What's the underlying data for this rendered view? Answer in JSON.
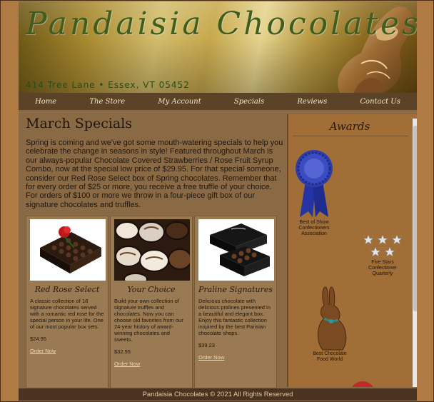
{
  "header": {
    "brand": "Pandaisia Chocolates",
    "address": "414 Tree Lane • Essex, VT 05452"
  },
  "nav": [
    "Home",
    "The Store",
    "My Account",
    "Specials",
    "Reviews",
    "Contact Us"
  ],
  "main": {
    "heading": "March Specials",
    "intro": "Spring is coming and we've got some mouth-watering specials to help you celebrate the change in seasons in style! Featured throughout March is our always-popular Chocolate Covered Strawberries / Rose Fruit Syrup Combo, now at the special low price of $29.95. For that special someone, consider our Red Rose Select box of Spring chocolates. Remember that for every order of $25 or more, you receive a free truffle of your choice. For orders of $100 or more we throw in a four-piece gift box of our signature chocolates and truffles.",
    "products": [
      {
        "title": "Red Rose Select",
        "description": "A classic collection of 18 signature chocolates served with a romantic red rose for the special person in your life. One of our most popular box sets.",
        "price": "$24.95",
        "order": "Order Now"
      },
      {
        "title": "Your Choice",
        "description": "Build your own collection of signature truffles and chocolates. Now you can choose old favorites from our 24-year history of award-winning chocolates and sweets.",
        "price": "$32.55",
        "order": "Order Now"
      },
      {
        "title": "Praline Signatures",
        "description": "Delicious chocolate with delicious pralines presented in a beautiful and elegant box. Enjoy this fantastic collection inspired by the best Parisian chocolate shops.",
        "price": "$39.23",
        "order": "Order Now"
      }
    ]
  },
  "sidebar": {
    "heading": "Awards",
    "awards": [
      "Best of Show Confectioners Association",
      "Five Stars Confectioner Quarterly",
      "Best Chocolate Food World"
    ]
  },
  "footer": "Pandaisia Chocolates © 2021 All Rights Reserved",
  "colors": {
    "accent_green": "#3f5e1e",
    "nav_bg": "#5a4327",
    "ribbon_blue": "#2f3fa8"
  }
}
